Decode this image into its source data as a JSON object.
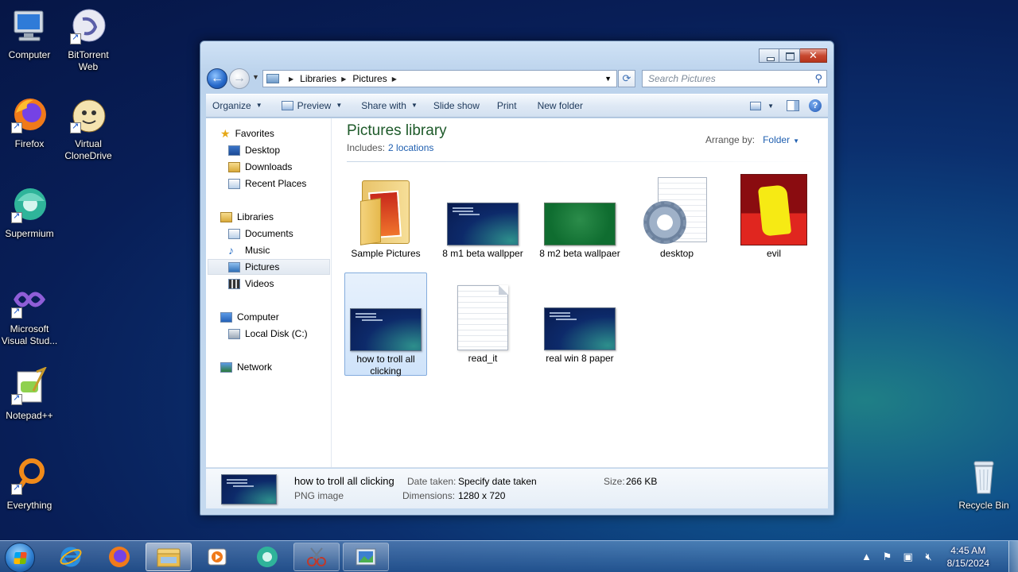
{
  "desktop": {
    "icons": [
      {
        "label": "Computer",
        "icon": "computer-icon"
      },
      {
        "label": "BitTorrent Web",
        "icon": "bittorrent-icon"
      },
      {
        "label": "Firefox",
        "icon": "firefox-icon"
      },
      {
        "label": "Virtual CloneDrive",
        "icon": "virtual-clonedrive-icon"
      },
      {
        "label": "Supermium",
        "icon": "supermium-icon"
      },
      {
        "label": "Microsoft Visual Stud...",
        "icon": "visual-studio-icon"
      },
      {
        "label": "Notepad++",
        "icon": "notepadpp-icon"
      },
      {
        "label": "Everything",
        "icon": "everything-icon"
      },
      {
        "label": "Recycle Bin",
        "icon": "recycle-bin-icon"
      }
    ]
  },
  "window": {
    "breadcrumb": [
      "Libraries",
      "Pictures"
    ],
    "search_placeholder": "Search Pictures",
    "toolbar": {
      "organize": "Organize",
      "preview": "Preview",
      "share_with": "Share with",
      "slide_show": "Slide show",
      "print": "Print",
      "new_folder": "New folder"
    },
    "nav": {
      "favorites": "Favorites",
      "desktop": "Desktop",
      "downloads": "Downloads",
      "recent_places": "Recent Places",
      "libraries": "Libraries",
      "documents": "Documents",
      "music": "Music",
      "pictures": "Pictures",
      "videos": "Videos",
      "computer": "Computer",
      "local_disk": "Local Disk (C:)",
      "network": "Network"
    },
    "library": {
      "title": "Pictures library",
      "includes_label": "Includes:",
      "includes_link": "2 locations",
      "arrange_label": "Arrange by:",
      "arrange_value": "Folder"
    },
    "items": [
      {
        "name": "Sample Pictures",
        "kind": "folder"
      },
      {
        "name": "8 m1 beta wallpper",
        "kind": "image-dark"
      },
      {
        "name": "8 m2 beta wallpaer",
        "kind": "image-green"
      },
      {
        "name": "desktop",
        "kind": "settings-file"
      },
      {
        "name": "evil",
        "kind": "image-evil"
      },
      {
        "name": "how to troll all clicking",
        "kind": "image-dark",
        "selected": true
      },
      {
        "name": "read_it",
        "kind": "text-file"
      },
      {
        "name": "real win 8 paper",
        "kind": "image-dark"
      }
    ],
    "details": {
      "name": "how to troll all clicking",
      "type": "PNG image",
      "date_taken_label": "Date taken:",
      "date_taken_value": "Specify date taken",
      "dimensions_label": "Dimensions:",
      "dimensions_value": "1280 x 720",
      "size_label": "Size:",
      "size_value": "266 KB"
    }
  },
  "taskbar": {
    "time": "4:45 AM",
    "date": "8/15/2024"
  }
}
